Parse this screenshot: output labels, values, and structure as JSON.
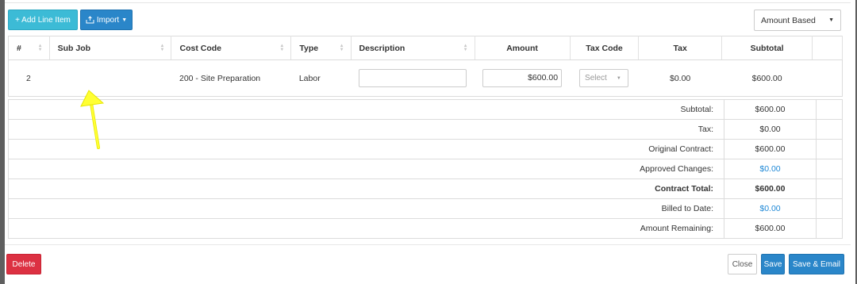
{
  "toolbar": {
    "add_line_item_label": "+ Add Line Item",
    "import_label": "Import",
    "amount_based_label": "Amount Based"
  },
  "table": {
    "headers": [
      "#",
      "Sub Job",
      "Cost Code",
      "Type",
      "Description",
      "Amount",
      "Tax Code",
      "Tax",
      "Subtotal"
    ],
    "rows": [
      {
        "num": "2",
        "sub_job": "",
        "cost_code": "200 - Site Preparation",
        "type": "Labor",
        "description": "",
        "amount": "$600.00",
        "tax_code_placeholder": "Select",
        "tax": "$0.00",
        "subtotal": "$600.00"
      }
    ]
  },
  "totals": [
    {
      "label": "Subtotal:",
      "value": "$600.00",
      "style": "normal"
    },
    {
      "label": "Tax:",
      "value": "$0.00",
      "style": "normal"
    },
    {
      "label": "Original Contract:",
      "value": "$600.00",
      "style": "normal"
    },
    {
      "label": "Approved Changes:",
      "value": "$0.00",
      "style": "link"
    },
    {
      "label": "Contract Total:",
      "value": "$600.00",
      "style": "bold"
    },
    {
      "label": "Billed to Date:",
      "value": "$0.00",
      "style": "link"
    },
    {
      "label": "Amount Remaining:",
      "value": "$600.00",
      "style": "normal"
    }
  ],
  "footer": {
    "delete_label": "Delete",
    "close_label": "Close",
    "save_label": "Save",
    "save_email_label": "Save & Email"
  },
  "colors": {
    "add_button": "#3cbbd6",
    "primary": "#2a86c9",
    "danger": "#dc3142",
    "link": "#1e88d6",
    "annotation_arrow": "#ffff33"
  },
  "icons": {
    "import": "import-tray-icon",
    "dropdown": "caret-down-icon",
    "sort": "sort-icon",
    "annotation": "arrow-up-icon"
  }
}
